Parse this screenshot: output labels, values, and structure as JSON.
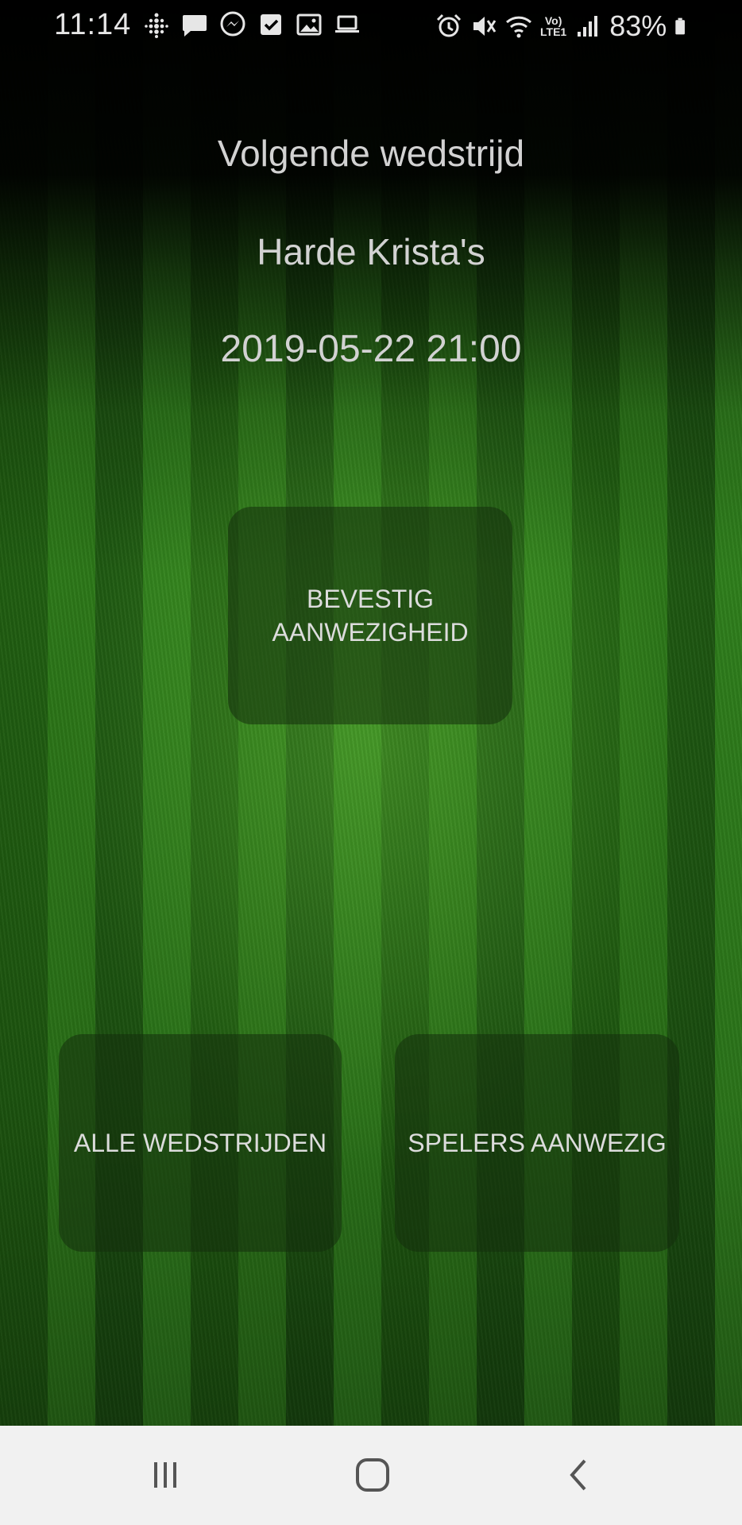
{
  "status_bar": {
    "time": "11:14",
    "left_icons": [
      "fitbit-icon",
      "message-icon",
      "messenger-icon",
      "checkbox-icon",
      "image-icon",
      "laptop-icon"
    ],
    "right_icons": [
      "alarm-icon",
      "mute-icon",
      "wifi-icon",
      "volte-icon",
      "signal-icon",
      "battery-icon"
    ],
    "volte_line1": "Vo)",
    "volte_line2": "LTE1",
    "battery_percent": "83%"
  },
  "header": {
    "title": "Volgende wedstrijd",
    "team": "Harde Krista's",
    "datetime": "2019-05-22 21:00"
  },
  "buttons": {
    "confirm_line1": "BEVESTIG",
    "confirm_line2": "AANWEZIGHEID",
    "all_matches": "ALLE WEDSTRIJDEN",
    "players_present": "SPELERS AANWEZIG"
  },
  "nav_bar": {
    "icons": [
      "recent-apps-icon",
      "home-icon",
      "back-icon"
    ]
  },
  "colors": {
    "text": "#d2d2d2",
    "button_bg": "#142d0c",
    "grass_dark": "#1e5a10",
    "grass_light": "#2d7a19",
    "nav_bg": "#f1f1f1"
  }
}
